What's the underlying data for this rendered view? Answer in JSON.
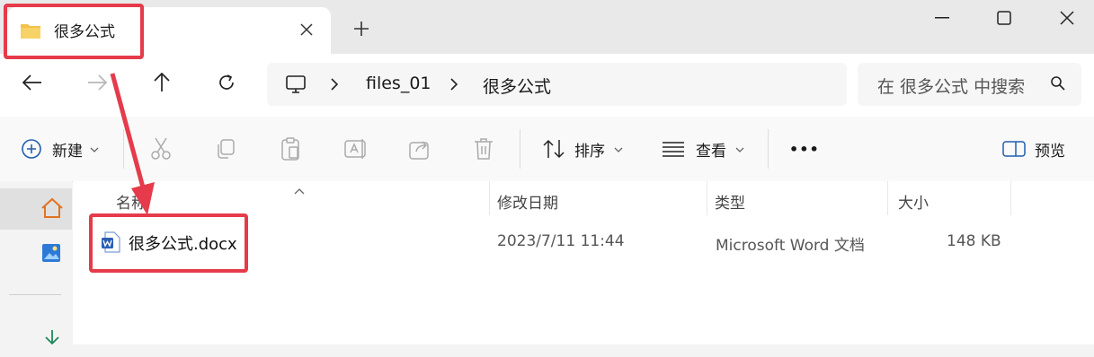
{
  "window": {
    "tab_title": "很多公式",
    "new_tab_symbol": "+"
  },
  "address": {
    "segments": [
      "files_01",
      "很多公式"
    ],
    "search_placeholder": "在 很多公式 中搜索"
  },
  "toolbar": {
    "new_label": "新建",
    "sort_label": "排序",
    "view_label": "查看",
    "more_label": "•••",
    "preview_label": "预览"
  },
  "columns": {
    "name": "名称",
    "date": "修改日期",
    "type": "类型",
    "size": "大小"
  },
  "files": [
    {
      "name": "很多公式.docx",
      "date": "2023/7/11 11:44",
      "type": "Microsoft Word 文档",
      "size": "148 KB"
    }
  ],
  "colors": {
    "highlight": "#e53b4a",
    "folder": "#f2c24a",
    "word": "#2b5fb5"
  }
}
